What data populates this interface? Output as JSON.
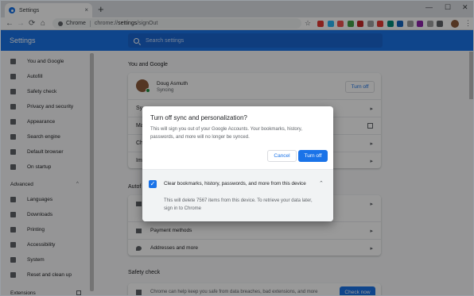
{
  "tab": {
    "title": "Settings",
    "close": "×"
  },
  "window": {
    "minimize": "—",
    "maximize": "☐",
    "close": "✕",
    "new_tab": "+"
  },
  "toolbar": {
    "back": "←",
    "forward": "→",
    "reload": "⟳",
    "home": "⌂",
    "omnibox_chrome": "Chrome",
    "url_prefix": "chrome://",
    "url_bold": "settings",
    "url_suffix": "/signOut",
    "star": "☆",
    "kebab": "⋮"
  },
  "extension_colors": [
    "#e53935",
    "#29b6f6",
    "#ef5350",
    "#43a047",
    "#c62828",
    "#9e9e9e",
    "#e53935",
    "#00897b",
    "#1565c0",
    "#9e9e9e",
    "#8e24aa",
    "#9e9e9e",
    "#5f6368"
  ],
  "header": {
    "title": "Settings",
    "search_placeholder": "Search settings"
  },
  "sidebar": {
    "items": [
      "You and Google",
      "Autofill",
      "Safety check",
      "Privacy and security",
      "Appearance",
      "Search engine",
      "Default browser",
      "On startup"
    ],
    "advanced": "Advanced",
    "advanced_items": [
      "Languages",
      "Downloads",
      "Printing",
      "Accessibility",
      "System",
      "Reset and clean up"
    ],
    "extensions": "Extensions"
  },
  "main": {
    "you_and_google": "You and Google",
    "user_name": "Doug Asmuth",
    "user_status": "Syncing",
    "turn_off": "Turn off",
    "row_stubs": [
      "Sy",
      "Ma",
      "Ch",
      "Im"
    ],
    "autofill": "Autof",
    "payment_methods": "Payment methods",
    "addresses": "Addresses and more",
    "safety_check": "Safety check",
    "safety_text": "Chrome can help keep you safe from data breaches, bad extensions, and more",
    "check_now": "Check now"
  },
  "dialog": {
    "title": "Turn off sync and personalization?",
    "body": "This will sign you out of your Google Accounts. Your bookmarks, history, passwords, and more will no longer be synced.",
    "cancel": "Cancel",
    "turn_off": "Turn off",
    "checkbox_label": "Clear bookmarks, history, passwords, and more from this device",
    "checkbox_desc": "This will delete 7567 items from this device. To retrieve your data later, sign in to Chrome",
    "checked": true
  }
}
